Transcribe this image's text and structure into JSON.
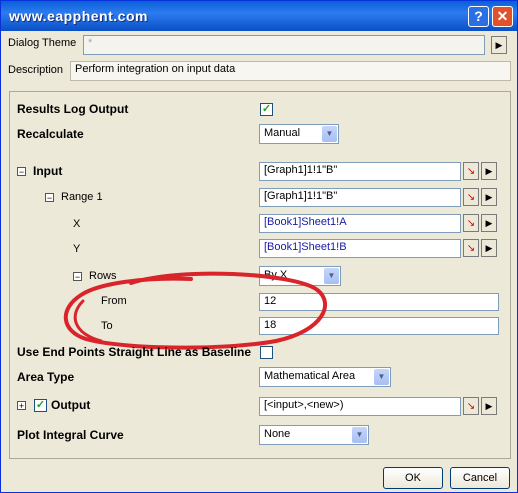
{
  "window": {
    "title": "www.eapphent.com",
    "help_glyph": "?",
    "close_glyph": "✕"
  },
  "dialog_theme": {
    "label": "Dialog Theme",
    "value": "*",
    "arrow": "▶"
  },
  "description": {
    "label": "Description",
    "value": "Perform integration on input data"
  },
  "settings": {
    "results_log": {
      "label": "Results Log Output",
      "checked_glyph": "✓"
    },
    "recalculate": {
      "label": "Recalculate",
      "value": "Manual"
    },
    "input": {
      "toggle": "−",
      "label": "Input",
      "value": "[Graph1]1!1\"B\""
    },
    "range1": {
      "toggle": "−",
      "label": "Range 1",
      "value": "[Graph1]1!1\"B\""
    },
    "x": {
      "label": "X",
      "value": "[Book1]Sheet1!A"
    },
    "y": {
      "label": "Y",
      "value": "[Book1]Sheet1!B"
    },
    "rows": {
      "toggle": "−",
      "label": "Rows",
      "value": "By X"
    },
    "from": {
      "label": "From",
      "value": "12"
    },
    "to": {
      "label": "To",
      "value": "18"
    },
    "end_points": {
      "label": "Use End Points Straight Line as Baseline"
    },
    "area_type": {
      "label": "Area Type",
      "value": "Mathematical Area"
    },
    "output": {
      "toggle": "+",
      "label": "Output",
      "checked_glyph": "✓",
      "value": "[<input>,<new>)"
    },
    "plot_curve": {
      "label": "Plot Integral Curve",
      "value": "None"
    }
  },
  "buttons": {
    "ok": "OK",
    "cancel": "Cancel"
  },
  "icons": {
    "dropdown_arrow": "▼",
    "picker": "↘",
    "menu_arrow": "▶"
  }
}
